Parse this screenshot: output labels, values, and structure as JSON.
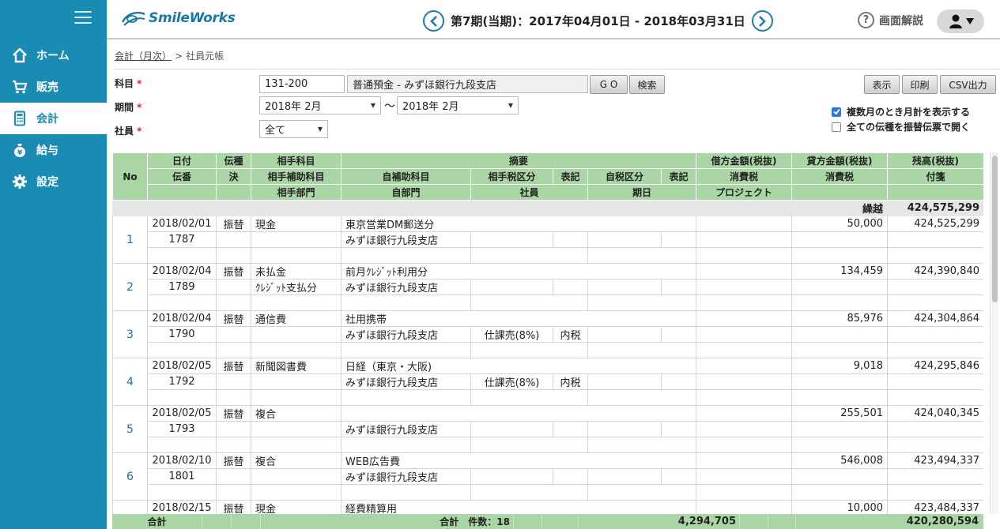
{
  "app": {
    "logo_text": "SmileWorks",
    "period_title": "第7期(当期)：2017年04月01日 - 2018年03月31日",
    "help_label": "画面解説",
    "brand_color": "#1a8bb2",
    "header_icons": [
      "chevron-left-icon",
      "chevron-right-icon",
      "help-icon",
      "user-icon"
    ]
  },
  "sidebar": {
    "items": [
      {
        "label": "ホーム",
        "icon": "home-icon"
      },
      {
        "label": "販売",
        "icon": "cart-icon"
      },
      {
        "label": "会計",
        "icon": "calculator-icon",
        "active": true
      },
      {
        "label": "給与",
        "icon": "yen-bag-icon"
      },
      {
        "label": "設定",
        "icon": "gear-icon"
      }
    ]
  },
  "breadcrumb": {
    "link": "会計（月次）",
    "separator": ">",
    "current": "社員元帳"
  },
  "form": {
    "account_label": "科目",
    "period_label": "期間",
    "employee_label": "社員",
    "required_mark": "*",
    "account_code": "131-200",
    "account_name": "普通預金 - みずほ銀行九段支店",
    "go_button": "G O",
    "search_button": "検索",
    "period_from": "2018年 2月",
    "period_sep": "〜",
    "period_to": "2018年 2月",
    "employee_value": "全て",
    "show_button": "表示",
    "print_button": "印刷",
    "csv_button": "CSV出力",
    "check_monthly_total": "複数月のとき月計を表示する",
    "check_monthly_total_on": true,
    "check_open_transfer": "全ての伝種を振替伝票で開く",
    "check_open_transfer_on": false
  },
  "table": {
    "h": {
      "no": "No",
      "date": "日付",
      "slip_no": "伝番",
      "type": "伝種",
      "settled": "決",
      "counter_account": "相手科目",
      "counter_sub": "相手補助科目",
      "counter_dept": "相手部門",
      "summary": "摘要",
      "own_sub": "自補助科目",
      "counter_tax": "相手税区分",
      "mark1": "表記",
      "own_tax": "自税区分",
      "mark2": "表記",
      "own_dept": "自部門",
      "employee": "社員",
      "due_date": "期日",
      "debit": "借方金額(税抜)",
      "tax1": "消費税",
      "project": "プロジェクト",
      "credit": "貸方金額(税抜)",
      "tax2": "消費税",
      "balance": "残高(税抜)",
      "tag": "付箋"
    },
    "carry_label": "繰越",
    "carry_balance": "424,575,299",
    "rows": [
      {
        "no": "1",
        "date": "2018/02/01",
        "slip": "1787",
        "type": "振替",
        "counter": "現金",
        "counter_sub": "",
        "summary": "東京営業DM郵送分",
        "own_sub": "みずほ銀行九段支店",
        "ctax": "",
        "m1": "",
        "debit": "",
        "credit": "50,000",
        "balance": "424,525,299"
      },
      {
        "no": "2",
        "date": "2018/02/04",
        "slip": "1789",
        "type": "振替",
        "counter": "未払金",
        "counter_sub": "ｸﾚｼﾞｯﾄ支払分",
        "summary": "前月ｸﾚｼﾞｯﾄ利用分",
        "own_sub": "みずほ銀行九段支店",
        "ctax": "",
        "m1": "",
        "debit": "",
        "credit": "134,459",
        "balance": "424,390,840"
      },
      {
        "no": "3",
        "date": "2018/02/04",
        "slip": "1790",
        "type": "振替",
        "counter": "通信費",
        "counter_sub": "",
        "summary": "社用携帯",
        "own_sub": "みずほ銀行九段支店",
        "ctax": "仕課売(8%)",
        "m1": "内税",
        "debit": "",
        "credit": "85,976",
        "balance": "424,304,864"
      },
      {
        "no": "4",
        "date": "2018/02/05",
        "slip": "1792",
        "type": "振替",
        "counter": "新聞図書費",
        "counter_sub": "",
        "summary": "日経（東京・大阪)",
        "own_sub": "みずほ銀行九段支店",
        "ctax": "仕課売(8%)",
        "m1": "内税",
        "debit": "",
        "credit": "9,018",
        "balance": "424,295,846"
      },
      {
        "no": "5",
        "date": "2018/02/05",
        "slip": "1793",
        "type": "振替",
        "counter": "複合",
        "counter_sub": "",
        "summary": "",
        "own_sub": "みずほ銀行九段支店",
        "ctax": "",
        "m1": "",
        "debit": "",
        "credit": "255,501",
        "balance": "424,040,345"
      },
      {
        "no": "6",
        "date": "2018/02/10",
        "slip": "1801",
        "type": "振替",
        "counter": "複合",
        "counter_sub": "",
        "summary": "WEB広告費",
        "own_sub": "みずほ銀行九段支店",
        "ctax": "",
        "m1": "",
        "debit": "",
        "credit": "546,008",
        "balance": "423,494,337"
      },
      {
        "no": "",
        "date": "2018/02/15",
        "slip": "",
        "type": "振替",
        "counter": "現金",
        "counter_sub": "",
        "summary": "経費精算用",
        "own_sub": "",
        "ctax": "",
        "m1": "",
        "debit": "",
        "credit": "10,000",
        "balance": "423,484,337"
      }
    ]
  },
  "footer": {
    "total_label": "合計",
    "count_label": "合計　件数：18",
    "credit_total": "4,294,705",
    "balance_total": "420,280,594"
  }
}
